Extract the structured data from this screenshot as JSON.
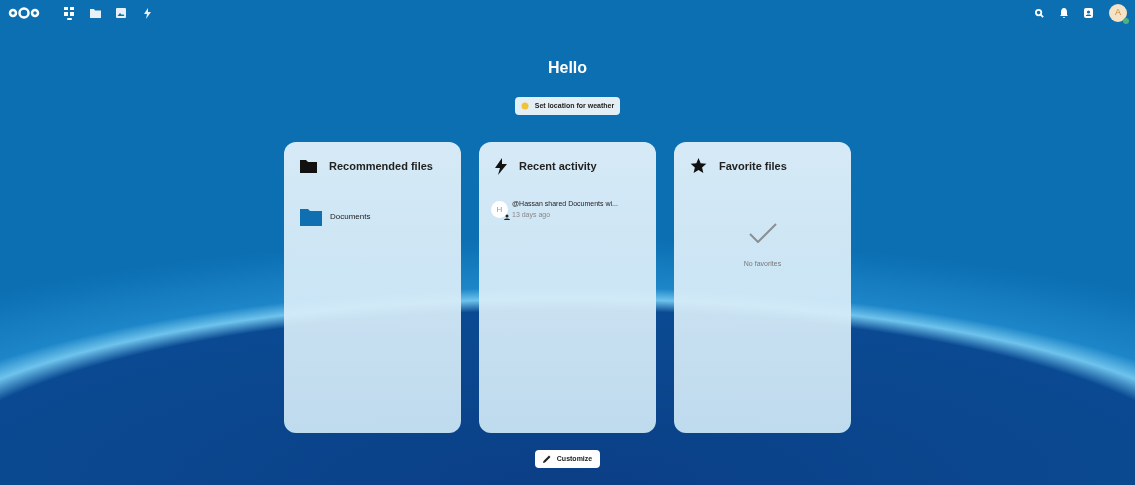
{
  "header": {
    "apps": [
      {
        "kind": "dashboard",
        "selected": true
      },
      {
        "kind": "files",
        "selected": false
      },
      {
        "kind": "photos",
        "selected": false
      },
      {
        "kind": "activity",
        "selected": false
      }
    ],
    "user": {
      "initial": "A"
    }
  },
  "greeting": "Hello",
  "weather_button": "Set location for weather",
  "widgets": [
    {
      "kind": "files",
      "title": "Recommended files",
      "items": [
        {
          "name": "Documents"
        }
      ]
    },
    {
      "kind": "activity",
      "title": "Recent activity",
      "items": [
        {
          "initial": "H",
          "text": "@Hassan shared Documents wi...",
          "time": "13 days ago"
        }
      ]
    },
    {
      "kind": "empty",
      "title": "Favorite files",
      "message": "No favorites"
    }
  ],
  "customize_button": "Customize"
}
